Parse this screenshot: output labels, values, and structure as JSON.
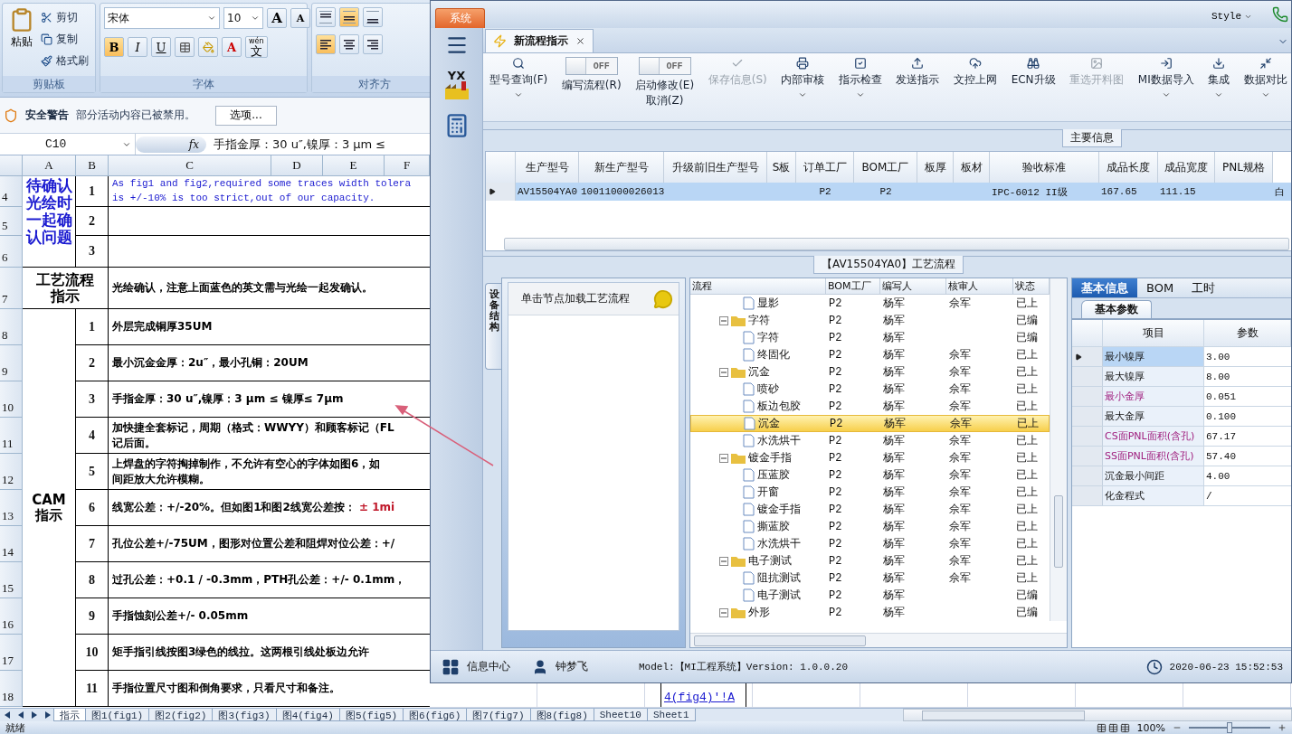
{
  "excel_ribbon": {
    "clipboard": {
      "paste": "粘贴",
      "actions": [
        "剪切",
        "复制",
        "格式刷"
      ],
      "label": "剪贴板"
    },
    "font": {
      "name": "宋体",
      "size": "10",
      "grow": "A",
      "shrink": "A",
      "styles": [
        {
          "label": "B",
          "kind": "bold",
          "selected": true
        },
        {
          "label": "I",
          "kind": "italic",
          "selected": false
        },
        {
          "label": "U",
          "kind": "underline",
          "selected": false
        }
      ],
      "font_color": "A",
      "phonetic_top": "wén",
      "phonetic": "文",
      "label": "字体"
    },
    "alignment": {
      "buttons": [
        {
          "kind": "top",
          "selected": false
        },
        {
          "kind": "middle",
          "selected": true
        },
        {
          "kind": "bottom",
          "selected": false
        },
        {
          "kind": "left",
          "selected": true
        },
        {
          "kind": "center",
          "selected": false
        },
        {
          "kind": "right",
          "selected": false
        }
      ],
      "label": "对齐方"
    }
  },
  "security_bar": {
    "title": "安全警告",
    "message": "部分活动内容已被禁用。",
    "button": "选项..."
  },
  "formula_bar": {
    "cell": "C10",
    "function_label": "fx",
    "formula": "手指金厚：30 u″,镍厚：3 μm ≤"
  },
  "sheet": {
    "columns": [
      "A",
      "B",
      "C",
      "D",
      "E",
      "F"
    ],
    "row_numbers": [
      "4",
      "5",
      "6",
      "7",
      "8",
      "9",
      "10",
      "11",
      "12",
      "13",
      "14",
      "15",
      "16",
      "17",
      "18"
    ],
    "sections": [
      {
        "kind": "questions",
        "title": "待确认光绘时一起确认问题",
        "items": [
          {
            "number": "1",
            "lines": [
              "As fig1 and fig2,required some traces width tolera",
              "is +/-10% is too strict,out of our capacity."
            ]
          },
          {
            "number": "2"
          },
          {
            "number": "3"
          }
        ]
      },
      {
        "kind": "note",
        "title": "工艺流程指示",
        "text": "光绘确认，注意上面蓝色的英文需与光绘一起发确认。"
      },
      {
        "kind": "list",
        "title": "CAM指示",
        "items": [
          {
            "number": "1",
            "text": "外层完成铜厚35UM"
          },
          {
            "number": "2",
            "text": "最小沉金金厚：2u″，最小孔铜：20UM"
          },
          {
            "number": "3",
            "text": "手指金厚：30 u″,镍厚：3 μm ≤ 镍厚≤ 7μm"
          },
          {
            "number": "4",
            "lines": [
              "加快捷全套标记，周期（格式：WWYY）和顾客标记（FL",
              "记后面。"
            ]
          },
          {
            "number": "5",
            "lines": [
              "上焊盘的字符掏掉制作，不允许有空心的字体如图6，如",
              "间距放大允许模糊。"
            ]
          },
          {
            "number": "6",
            "text": "线宽公差：+/-20%。但如图1和图2线宽公差按：",
            "emphasis": "± 1mi"
          },
          {
            "number": "7",
            "text": "孔位公差+/-75UM，图形对位置公差和阻焊对位公差：+/"
          },
          {
            "number": "8",
            "text": "过孔公差：+0.1 / -0.3mm，PTH孔公差：+/- 0.1mm，"
          },
          {
            "number": "9",
            "text": "手指蚀刻公差+/- 0.05mm"
          },
          {
            "number": "10",
            "text": "矩手指引线按图3绿色的线拉。这两根引线处板边允许"
          },
          {
            "number": "11",
            "text": "手指位置尺寸图和倒角要求，只看尺寸和备注。"
          }
        ]
      }
    ]
  },
  "app": {
    "system_tab": "系统",
    "style_menu": "Style",
    "logo_text": "YX",
    "document_tab": {
      "label": "新流程指示",
      "selected": true
    },
    "toolbar": [
      {
        "kind": "button",
        "label": "型号查询(F)",
        "dropdown": true,
        "disabled": false
      },
      {
        "kind": "toggle",
        "label": "编写流程(R)",
        "switch_text": "OFF",
        "on": false
      },
      {
        "kind": "toggle",
        "label": "启动修改(E)\n取消(Z)",
        "switch_text": "OFF",
        "on": false
      },
      {
        "kind": "button",
        "label": "保存信息(S)",
        "dropdown": false,
        "disabled": true
      },
      {
        "kind": "button",
        "label": "内部审核",
        "dropdown": true,
        "disabled": false
      },
      {
        "kind": "button",
        "label": "指示检查",
        "dropdown": true,
        "disabled": false
      },
      {
        "kind": "button",
        "label": "发送指示",
        "dropdown": false,
        "disabled": false
      },
      {
        "kind": "button",
        "label": "文控上网",
        "dropdown": false,
        "disabled": false
      },
      {
        "kind": "button",
        "label": "ECN升级",
        "dropdown": false,
        "disabled": false
      },
      {
        "kind": "button",
        "label": "重选开料图",
        "dropdown": false,
        "disabled": true
      },
      {
        "kind": "button",
        "label": "MI数据导入",
        "dropdown": true,
        "disabled": false
      },
      {
        "kind": "button",
        "label": "集成",
        "dropdown": true,
        "disabled": false
      },
      {
        "kind": "button",
        "label": "数据对比",
        "dropdown": true,
        "disabled": false
      }
    ],
    "main_info": {
      "title": "主要信息",
      "columns": [
        "生产型号",
        "新生产型号",
        "升级前旧生产型号",
        "S板",
        "订单工厂",
        "BOM工厂",
        "板厚",
        "板材",
        "验收标准",
        "成品长度",
        "成品宽度",
        "PNL规格"
      ],
      "rows": [
        {
          "selected": true,
          "cells": [
            "AV15504YA0",
            "10011000026013",
            null,
            null,
            "P2",
            "P2",
            null,
            null,
            "IPC-6012 II级",
            "167.65",
            "111.15",
            null,
            "白"
          ]
        }
      ]
    },
    "process": {
      "title": "【AV15504YA0】工艺流程",
      "side_tab": "设备结构",
      "hint": "单击节点加载工艺流程",
      "columns": [
        "流程",
        "BOM工厂",
        "编写人",
        "核审人",
        "状态"
      ],
      "tree": [
        {
          "kind": "file",
          "name": "显影",
          "factory": "P2",
          "author": "杨军",
          "reviewer": "佘军",
          "status": "已上",
          "selected": false
        },
        {
          "kind": "folder",
          "name": "字符",
          "factory": "P2",
          "author": "杨军",
          "status": "已编",
          "selected": false,
          "expanded": true,
          "children": [
            {
              "kind": "file",
              "name": "字符",
              "factory": "P2",
              "author": "杨军",
              "status": "已编",
              "selected": false
            },
            {
              "kind": "file",
              "name": "终固化",
              "factory": "P2",
              "author": "杨军",
              "reviewer": "佘军",
              "status": "已上",
              "selected": false
            }
          ]
        },
        {
          "kind": "folder",
          "name": "沉金",
          "factory": "P2",
          "author": "杨军",
          "reviewer": "佘军",
          "status": "已上",
          "selected": false,
          "expanded": true,
          "children": [
            {
              "kind": "file",
              "name": "喷砂",
              "factory": "P2",
              "author": "杨军",
              "reviewer": "佘军",
              "status": "已上",
              "selected": false
            },
            {
              "kind": "file",
              "name": "板边包胶",
              "factory": "P2",
              "author": "杨军",
              "reviewer": "佘军",
              "status": "已上",
              "selected": false
            },
            {
              "kind": "file",
              "name": "沉金",
              "factory": "P2",
              "author": "杨军",
              "reviewer": "佘军",
              "status": "已上",
              "selected": true
            },
            {
              "kind": "file",
              "name": "水洗烘干",
              "factory": "P2",
              "author": "杨军",
              "reviewer": "佘军",
              "status": "已上",
              "selected": false
            }
          ]
        },
        {
          "kind": "folder",
          "name": "镀金手指",
          "factory": "P2",
          "author": "杨军",
          "reviewer": "佘军",
          "status": "已上",
          "selected": false,
          "expanded": true,
          "children": [
            {
              "kind": "file",
              "name": "压蓝胶",
              "factory": "P2",
              "author": "杨军",
              "reviewer": "佘军",
              "status": "已上",
              "selected": false
            },
            {
              "kind": "file",
              "name": "开窗",
              "factory": "P2",
              "author": "杨军",
              "reviewer": "佘军",
              "status": "已上",
              "selected": false
            },
            {
              "kind": "file",
              "name": "镀金手指",
              "factory": "P2",
              "author": "杨军",
              "reviewer": "佘军",
              "status": "已上",
              "selected": false
            },
            {
              "kind": "file",
              "name": "撕蓝胶",
              "factory": "P2",
              "author": "杨军",
              "reviewer": "佘军",
              "status": "已上",
              "selected": false
            },
            {
              "kind": "file",
              "name": "水洗烘干",
              "factory": "P2",
              "author": "杨军",
              "reviewer": "佘军",
              "status": "已上",
              "selected": false
            }
          ]
        },
        {
          "kind": "folder",
          "name": "电子测试",
          "factory": "P2",
          "author": "杨军",
          "reviewer": "佘军",
          "status": "已上",
          "selected": false,
          "expanded": true,
          "children": [
            {
              "kind": "file",
              "name": "阻抗测试",
              "factory": "P2",
              "author": "杨军",
              "reviewer": "佘军",
              "status": "已上",
              "selected": false
            },
            {
              "kind": "file",
              "name": "电子测试",
              "factory": "P2",
              "author": "杨军",
              "status": "已编",
              "selected": false
            }
          ]
        },
        {
          "kind": "folder",
          "name": "外形",
          "factory": "P2",
          "author": "杨军",
          "status": "已编",
          "selected": false,
          "expanded": true
        }
      ]
    },
    "detail": {
      "tabs": [
        {
          "label": "基本信息",
          "selected": true
        },
        {
          "label": "BOM",
          "selected": false
        },
        {
          "label": "工时",
          "selected": false
        }
      ],
      "sub_tab": "基本参数",
      "columns": [
        "项目",
        "参数"
      ],
      "rows": [
        {
          "label": "最小镍厚",
          "value": "3.00",
          "highlight": false,
          "selected": true
        },
        {
          "label": "最大镍厚",
          "value": "8.00",
          "highlight": false,
          "selected": false
        },
        {
          "label": "最小金厚",
          "value": "0.051",
          "highlight": true,
          "selected": false
        },
        {
          "label": "最大金厚",
          "value": "0.100",
          "highlight": false,
          "selected": false
        },
        {
          "label": "CS面PNL面积(含孔)",
          "value": "67.17",
          "highlight": true,
          "selected": false
        },
        {
          "label": "SS面PNL面积(含孔)",
          "value": "57.40",
          "highlight": true,
          "selected": false
        },
        {
          "label": "沉金最小间距",
          "value": "4.00",
          "highlight": false,
          "selected": false
        },
        {
          "label": "化金程式",
          "value": "/",
          "highlight": false,
          "selected": false
        }
      ]
    },
    "status": {
      "info_center": "信息中心",
      "user": "钟梦飞",
      "model": "Model:【MI工程系统】Version: 1.0.0.20",
      "datetime": "2020-06-23 15:52:53"
    }
  },
  "sheet_strip": {
    "link_cell": "4(fig4)'!A"
  },
  "sheet_tabs": [
    {
      "label": "指示",
      "selected": true
    },
    {
      "label": "图1(fig1)",
      "selected": false
    },
    {
      "label": "图2(fig2)",
      "selected": false
    },
    {
      "label": "图3(fig3)",
      "selected": false
    },
    {
      "label": "图4(fig4)",
      "selected": false
    },
    {
      "label": "图5(fig5)",
      "selected": false
    },
    {
      "label": "图6(fig6)",
      "selected": false
    },
    {
      "label": "图7(fig7)",
      "selected": false
    },
    {
      "label": "图8(fig8)",
      "selected": false
    },
    {
      "label": "Sheet10",
      "selected": false
    },
    {
      "label": "Sheet1",
      "selected": false
    }
  ],
  "excel_status": {
    "ready": "就绪",
    "zoom": "100%",
    "zoom_slider": {
      "level": 0.5
    }
  }
}
